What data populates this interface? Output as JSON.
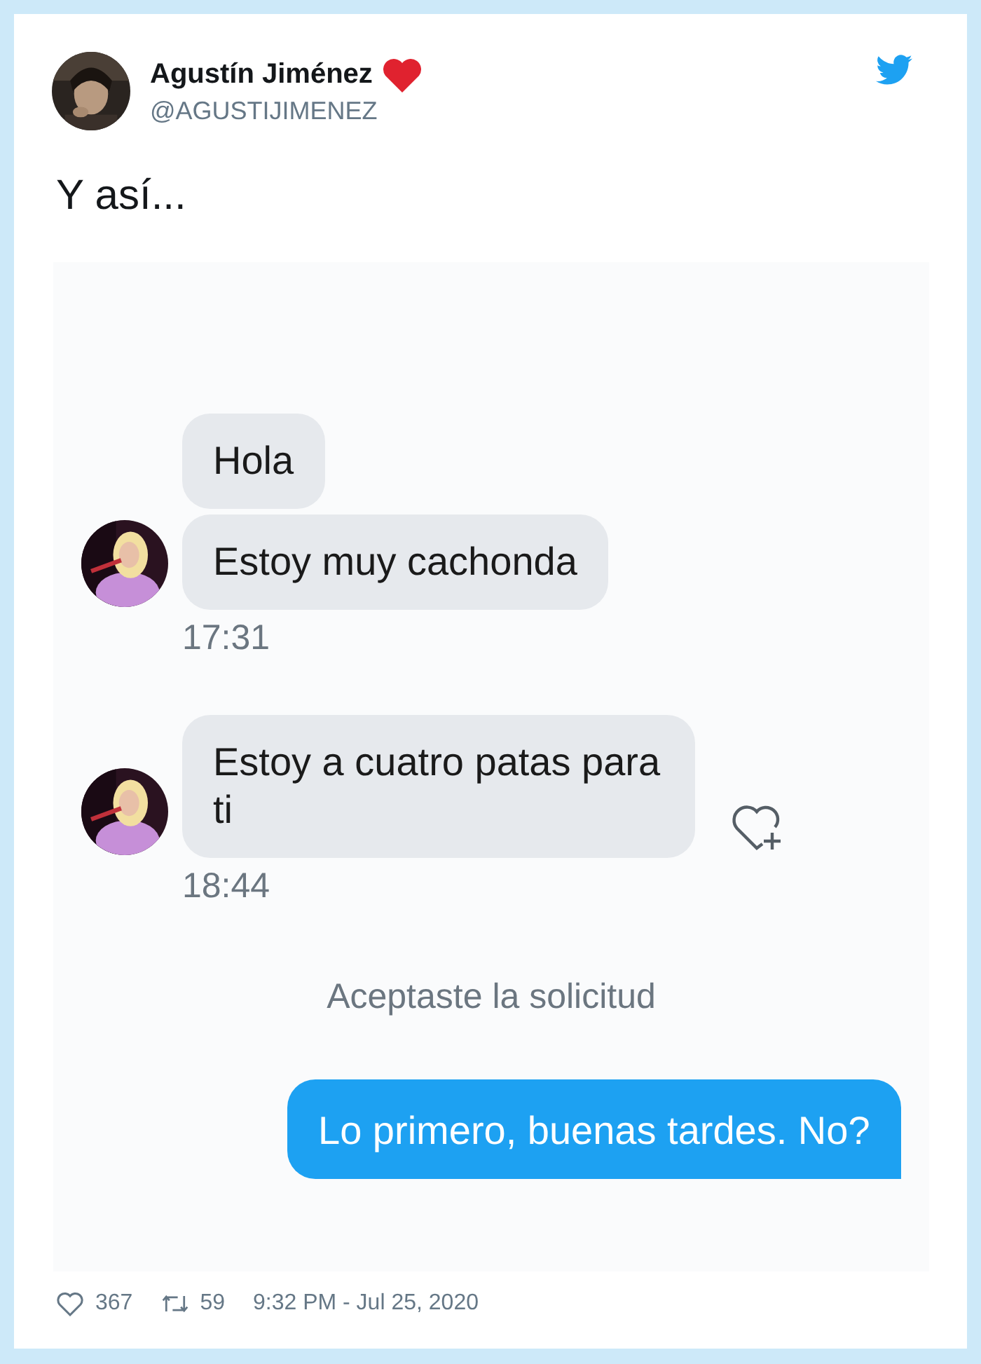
{
  "tweet": {
    "author": {
      "name": "Agustín Jiménez",
      "handle": "@AGUSTIJIMENEZ"
    },
    "text": "Y así...",
    "screenshot": {
      "conversation": [
        {
          "kind": "incoming",
          "bubbles": [
            "Hola",
            "Estoy muy cachonda"
          ],
          "time": "17:31",
          "like_button": false
        },
        {
          "kind": "incoming",
          "bubbles": [
            "Estoy a cuatro patas para ti"
          ],
          "time": "18:44",
          "like_button": true
        },
        {
          "kind": "notice",
          "text": "Aceptaste la solicitud"
        },
        {
          "kind": "outgoing",
          "bubbles": [
            "Lo primero, buenas tardes. No?"
          ]
        }
      ]
    },
    "footer": {
      "likes": "367",
      "retweets": "59",
      "timestamp": "9:32 PM - Jul 25, 2020"
    }
  }
}
